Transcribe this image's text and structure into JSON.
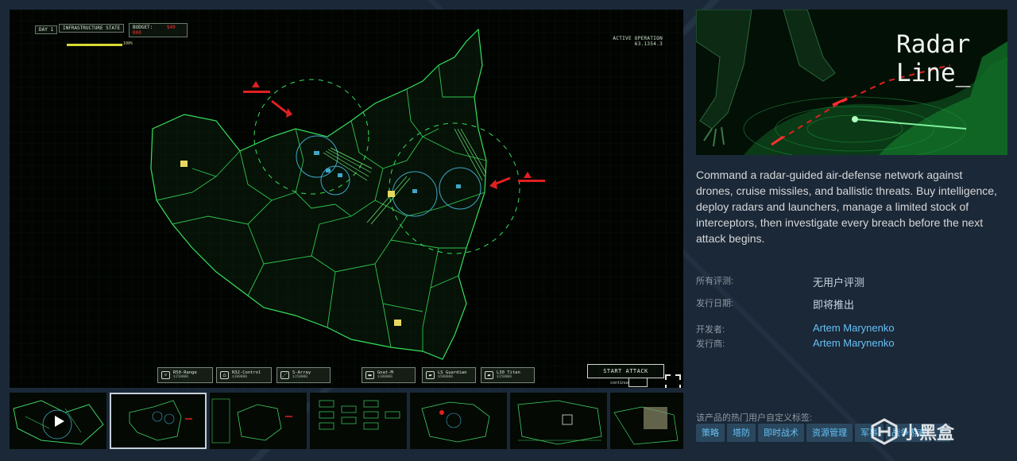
{
  "hud": {
    "day": "DAY 1",
    "infrastructure": "INFRASTRUCTURE STATE",
    "infrastructure_pct": "100%",
    "budget_label": "BUDGET:",
    "budget_value": "$40 000",
    "active_operation": "ACTIVE OPERATION",
    "operation_code": "63.1354.3"
  },
  "units": [
    {
      "name": "R50-Range",
      "price": "$150000"
    },
    {
      "name": "R32-Control",
      "price": "$100000"
    },
    {
      "name": "S-Array",
      "price": "$150000"
    },
    {
      "name": "Gnat-M",
      "price": "$100000"
    },
    {
      "name": "LS Guardian",
      "price": "$500000"
    },
    {
      "name": "L30 Titan",
      "price": "$150000"
    }
  ],
  "start_attack": "START ATTACK",
  "continue_text": "continue",
  "capsule_title": "Radar\nLine_",
  "description": "Command a radar-guided air-defense network against drones, cruise missiles, and ballistic threats. Buy intelligence, deploy radars and launchers, manage a limited stock of interceptors, then investigate every breach before the next attack begins.",
  "meta": {
    "reviews_label": "所有评测:",
    "reviews_value": "无用户评测",
    "release_label": "发行日期:",
    "release_value": "即将推出",
    "developer_label": "开发者:",
    "developer_value": "Artem Marynenko",
    "publisher_label": "发行商:",
    "publisher_value": "Artem Marynenko"
  },
  "tags_label": "该产品的热门用户自定义标签:",
  "tags": [
    "策略",
    "塔防",
    "即时战术",
    "资源管理",
    "军事",
    "战争游戏",
    "+"
  ],
  "watermark": "小黑盒",
  "colors": {
    "map_green": "#35e05a",
    "threat_red": "#e02020",
    "radar_blue": "#3fa7c8",
    "link_blue": "#66c0f4",
    "tag_bg": "#2a475e"
  }
}
